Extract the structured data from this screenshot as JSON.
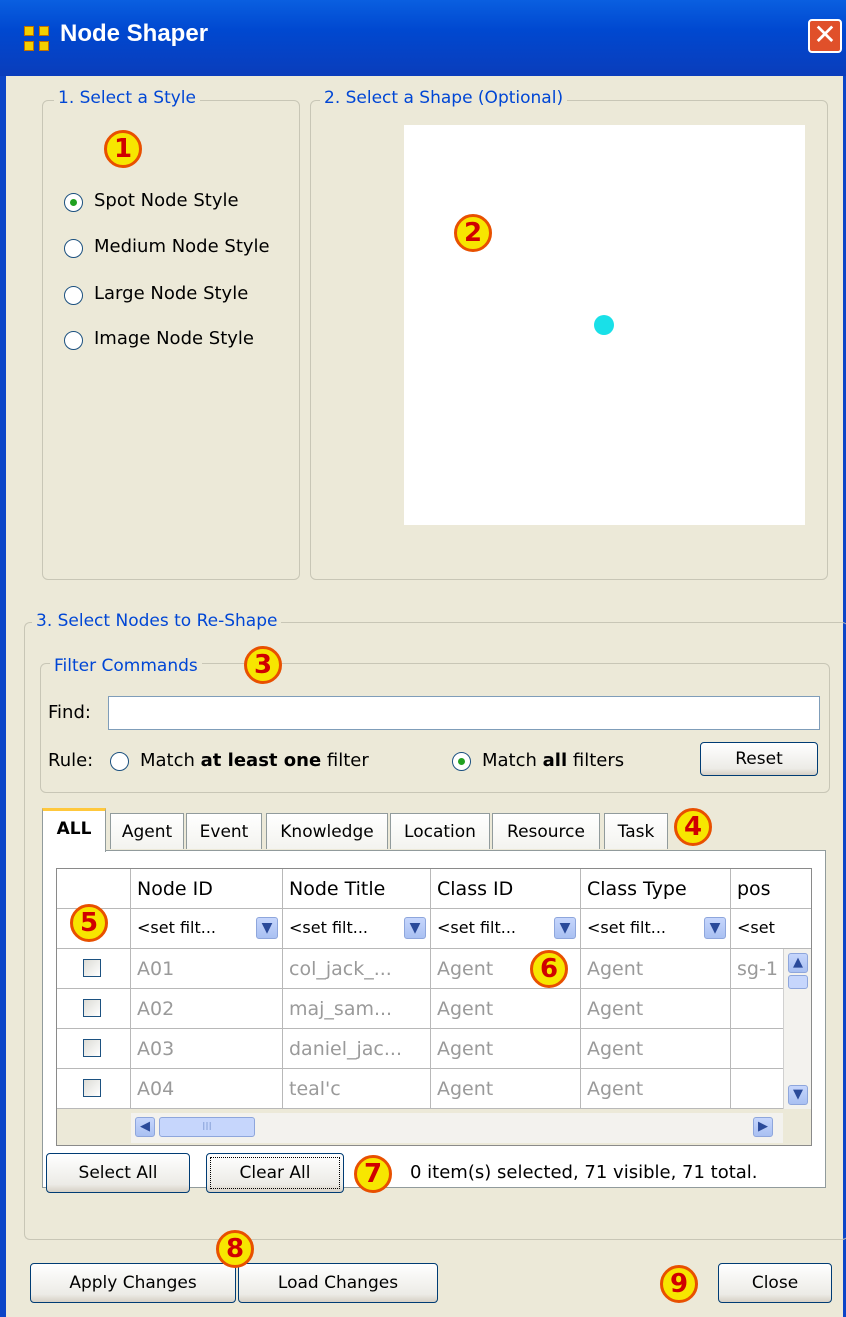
{
  "window": {
    "title": "Node Shaper",
    "close_glyph": "✕"
  },
  "style_group": {
    "legend": "1. Select a Style",
    "options": [
      {
        "label": "Spot Node Style",
        "checked": true
      },
      {
        "label": "Medium Node Style",
        "checked": false
      },
      {
        "label": "Large Node Style",
        "checked": false
      },
      {
        "label": "Image Node Style",
        "checked": false
      }
    ]
  },
  "shape_group": {
    "legend": "2. Select a Shape (Optional)",
    "preview_dot_color": "#19e0e8"
  },
  "nodes_group": {
    "legend": "3. Select Nodes to Re-Shape",
    "filter": {
      "legend": "Filter Commands",
      "find_label": "Find:",
      "find_value": "",
      "rule_label": "Rule:",
      "rule_one_prefix": "Match ",
      "rule_one_bold": "at least one",
      "rule_one_suffix": " filter",
      "rule_all_prefix": "Match ",
      "rule_all_bold": "all",
      "rule_all_suffix": " filters",
      "rule_selected": "all",
      "reset_label": "Reset"
    },
    "tabs": [
      "ALL",
      "Agent",
      "Event",
      "Knowledge",
      "Location",
      "Resource",
      "Task"
    ],
    "active_tab": "ALL",
    "table": {
      "columns": [
        "Node ID",
        "Node Title",
        "Class ID",
        "Class Type",
        "pos"
      ],
      "filter_placeholder": "<set filt...",
      "filter_placeholder_cut": "<set",
      "rows": [
        [
          "A01",
          "col_jack_...",
          "Agent",
          "Agent",
          "sg-1"
        ],
        [
          "A02",
          "maj_sam...",
          "Agent",
          "Agent",
          ""
        ],
        [
          "A03",
          "daniel_jac...",
          "Agent",
          "Agent",
          ""
        ],
        [
          "A04",
          "teal'c",
          "Agent",
          "Agent",
          ""
        ]
      ],
      "hscroll_grip": "III"
    },
    "select_all_label": "Select All",
    "clear_all_label": "Clear All",
    "status": "0 item(s) selected, 71 visible, 71 total."
  },
  "footer": {
    "apply_label": "Apply Changes",
    "load_label": "Load Changes",
    "close_label": "Close"
  },
  "callouts": [
    "1",
    "2",
    "3",
    "4",
    "5",
    "6",
    "7",
    "8",
    "9"
  ],
  "colors": {
    "title_bar": "#0048d0",
    "legend_text": "#0046d5",
    "callout_fill": "#f7e600",
    "callout_border": "#e85000",
    "callout_text": "#d00000"
  }
}
